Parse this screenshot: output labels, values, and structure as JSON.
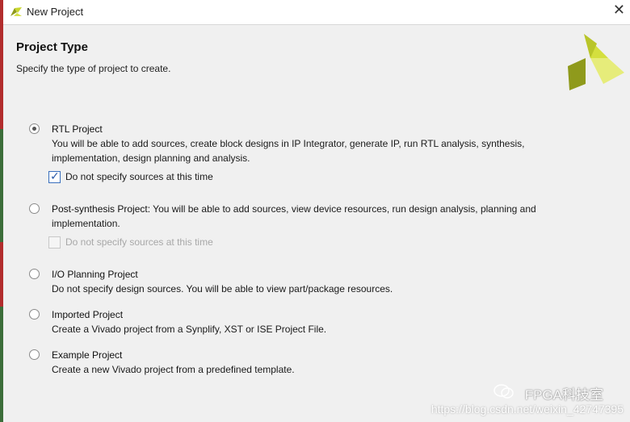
{
  "window": {
    "title": "New Project",
    "close_glyph": "✕"
  },
  "header": {
    "title": "Project Type",
    "subtitle": "Specify the type of project to create."
  },
  "options": [
    {
      "title": "RTL Project",
      "description": "You will be able to add sources, create block designs in IP Integrator, generate IP, run RTL analysis, synthesis, implementation, design planning and analysis.",
      "selected": true,
      "checkbox": {
        "label": "Do not specify sources at this time",
        "checked": true,
        "enabled": true
      }
    },
    {
      "title": "Post-synthesis Project:",
      "description": "You will be able to add sources, view device resources, run design analysis, planning and implementation.",
      "selected": false,
      "checkbox": {
        "label": "Do not specify sources at this time",
        "checked": false,
        "enabled": false
      }
    },
    {
      "title": "I/O Planning Project",
      "description": "Do not specify design sources. You will be able to view part/package resources.",
      "selected": false
    },
    {
      "title": "Imported Project",
      "description": "Create a Vivado project from a Synplify, XST or ISE Project File.",
      "selected": false
    },
    {
      "title": "Example Project",
      "description": "Create a new Vivado project from a predefined template.",
      "selected": false
    }
  ],
  "watermark": {
    "name": "FPGA科技室",
    "url": "https://blog.csdn.net/weixin_42747395"
  },
  "colors": {
    "logo_lime": "#c8d62b",
    "logo_olive": "#8f9a1c",
    "checkbox_blue": "#3a6fbd"
  }
}
